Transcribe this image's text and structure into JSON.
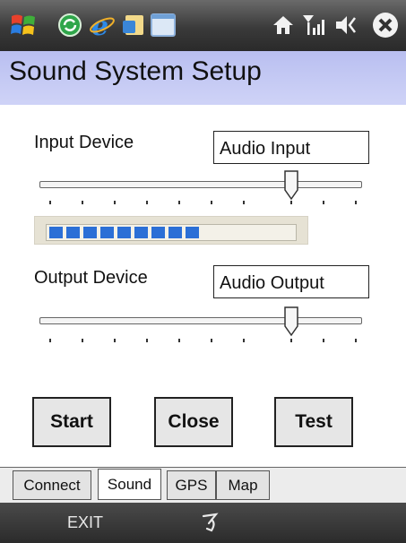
{
  "taskbar": {
    "icons": [
      "windows-start-icon",
      "sync-icon",
      "internet-explorer-icon",
      "messaging-icon",
      "window-icon",
      "home-icon",
      "signal-icon",
      "volume-icon",
      "close-icon"
    ]
  },
  "title": "Sound System Setup",
  "input": {
    "label": "Input Device",
    "value": "Audio Input",
    "slider_position": 0.78,
    "level_segments": 9
  },
  "output": {
    "label": "Output Device",
    "value": "Audio Output",
    "slider_position": 0.78
  },
  "buttons": {
    "start": "Start",
    "close": "Close",
    "test": "Test"
  },
  "tabs": [
    {
      "label": "Connect",
      "active": false
    },
    {
      "label": "Sound",
      "active": true
    },
    {
      "label": "GPS",
      "active": false
    },
    {
      "label": "Map",
      "active": false
    }
  ],
  "softkeys": {
    "left": "EXIT"
  }
}
